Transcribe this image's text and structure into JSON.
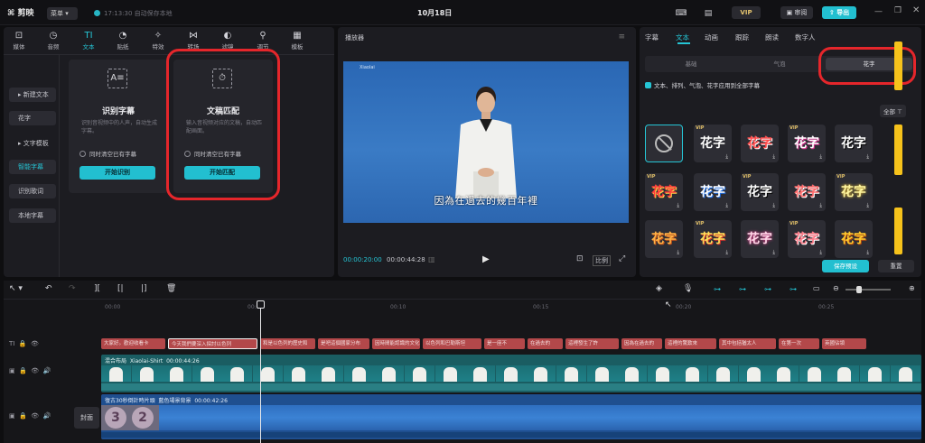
{
  "app": {
    "logo": "剪映",
    "menu_label": "菜单",
    "autosave": "17:13:30 自动保存本地",
    "doc_title": "10月18日",
    "vip": "VIP",
    "review": "审阅",
    "export": "导出"
  },
  "toolbar": {
    "tabs": [
      "媒体",
      "音频",
      "文本",
      "贴纸",
      "特效",
      "转场",
      "滤镜",
      "调节",
      "模板"
    ],
    "active": "文本"
  },
  "sidebar": {
    "items": [
      "新建文本",
      "花字",
      "文字模板",
      "智能字幕",
      "识别歌词",
      "本地字幕"
    ],
    "active": "智能字幕"
  },
  "cards": [
    {
      "title": "识别字幕",
      "desc": "识别音视频中的人声，自动生成字幕。",
      "check": "同时清空已有字幕",
      "button": "开始识别"
    },
    {
      "title": "文稿匹配",
      "desc": "输入音视频对应的文稿，自动匹配画面。",
      "check": "同时清空已有字幕",
      "button": "开始匹配"
    }
  ],
  "player": {
    "title": "播放器",
    "caption": "因為在過去的幾百年裡",
    "time_current": "00:00:20:00",
    "time_total": "00:00:44:28",
    "ratio": "比例",
    "watermark": "Xiaolai"
  },
  "rightpanel": {
    "tabs": [
      "字幕",
      "文本",
      "动画",
      "跟踪",
      "朗读",
      "数字人"
    ],
    "active_tab": "文本",
    "segments": [
      "基础",
      "气泡",
      "花字"
    ],
    "active_segment": "花字",
    "apply_all": "文本、排列、气泡、花字应用到全部字幕",
    "filter": "全部",
    "tile_text": "花字",
    "vip_badge": "VIP",
    "save_preset": "保存预设",
    "reset": "重置"
  },
  "timeline": {
    "ruler": [
      "00:00",
      "00:05",
      "00:10",
      "00:15",
      "00:20",
      "00:25"
    ],
    "text_clips": [
      "大家好。歡迎收看卡",
      "今天我們要深入探討以色列",
      "和是以色列的歷史和",
      "是吧這個國家分布",
      "因時間能認識的文化",
      "以色列和巴勒斯坦",
      "是一座不",
      "在過去的",
      "這裡發生了許",
      "因為在過去的",
      "這裡的驚歎來",
      "其中包括猶太人",
      "在第一次",
      "英國佔領"
    ],
    "video_track1": {
      "name": "混合布局",
      "file": "Xiaolai-Shirt",
      "duration": "00:00:44:26"
    },
    "video_track2": {
      "name": "復古30秒倒計時片頭",
      "file": "藍色場景背景",
      "duration": "00:00:42:26"
    },
    "cover_label": "封面",
    "countdown": [
      "3",
      "2"
    ]
  },
  "colors": {
    "accent": "#25c5d5",
    "red_highlight": "#e5262b",
    "annotation_yellow": "#f6c21b"
  }
}
